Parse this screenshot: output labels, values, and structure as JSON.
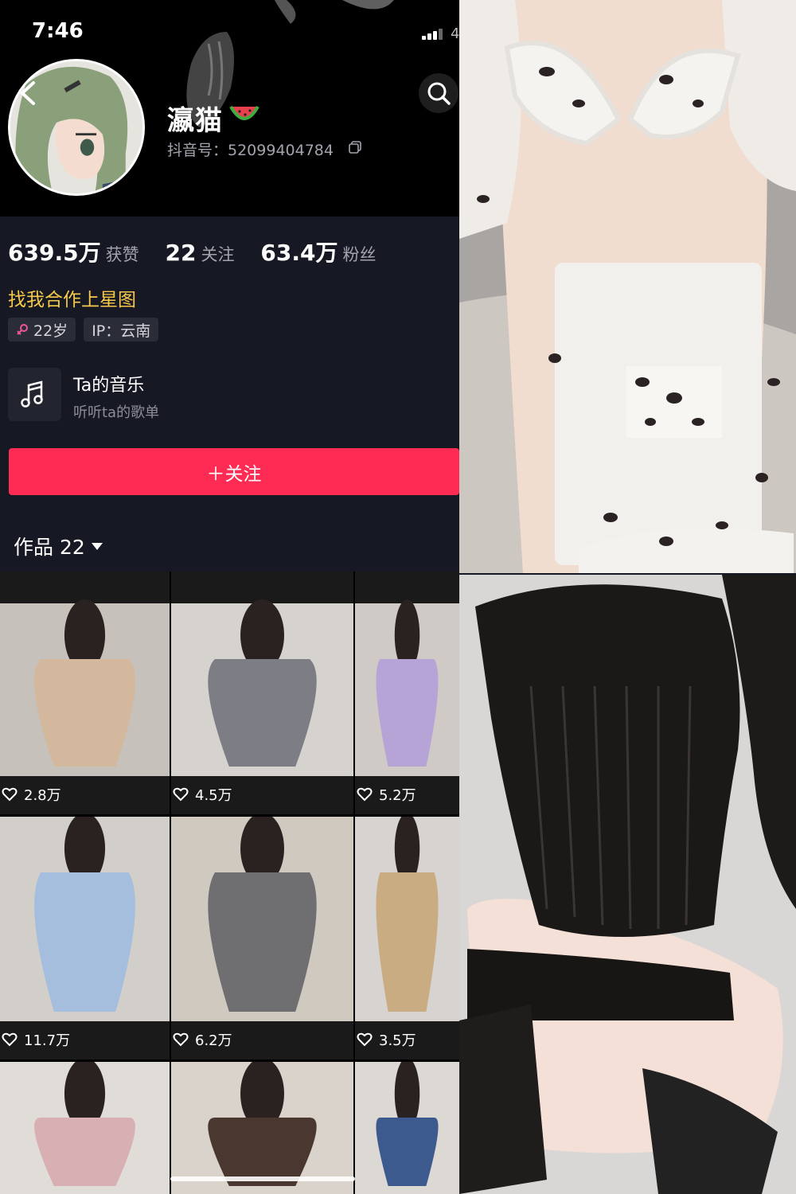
{
  "status_bar": {
    "time": "7:46",
    "battery": "4"
  },
  "profile": {
    "name": "瀛猫",
    "douyin_id": "抖音号：52099404784",
    "stats": [
      {
        "value": "639.5万",
        "label": "获赞"
      },
      {
        "value": "22",
        "label": "关注"
      },
      {
        "value": "63.4万",
        "label": "粉丝"
      }
    ],
    "bio": "找我合作上星图",
    "tags": {
      "age": "22岁",
      "ip": "IP：云南"
    },
    "music": {
      "title": "Ta的音乐",
      "subtitle": "听听ta的歌单"
    },
    "follow_label": "＋关注"
  },
  "works": {
    "tab_label": "作品 22",
    "items": [
      {
        "likes": "2.8万",
        "dress_color": "#d3b89d",
        "bg": "#c6c1bb"
      },
      {
        "likes": "4.5万",
        "dress_color": "#7d7e85",
        "bg": "#d6d2cd"
      },
      {
        "likes": "5.2万",
        "dress_color": "#b6a4d6",
        "bg": "#cfcac5"
      },
      {
        "likes": "11.7万",
        "dress_color": "#a6bede",
        "bg": "#d2cfcb"
      },
      {
        "likes": "6.2万",
        "dress_color": "#6f6f72",
        "bg": "#cfc9c0"
      },
      {
        "likes": "3.5万",
        "dress_color": "#c9ac82",
        "bg": "#d6d3d0"
      },
      {
        "likes": "",
        "dress_color": "#d8b0b4",
        "bg": "#e0dcd8"
      },
      {
        "likes": "",
        "dress_color": "#4a3830",
        "bg": "#d9d3cc"
      },
      {
        "likes": "",
        "dress_color": "#3c5a8e",
        "bg": "#dcd8d3"
      }
    ]
  },
  "colors": {
    "accent": "#fe2c55",
    "bio": "#f6c94a",
    "background": "#161824"
  }
}
